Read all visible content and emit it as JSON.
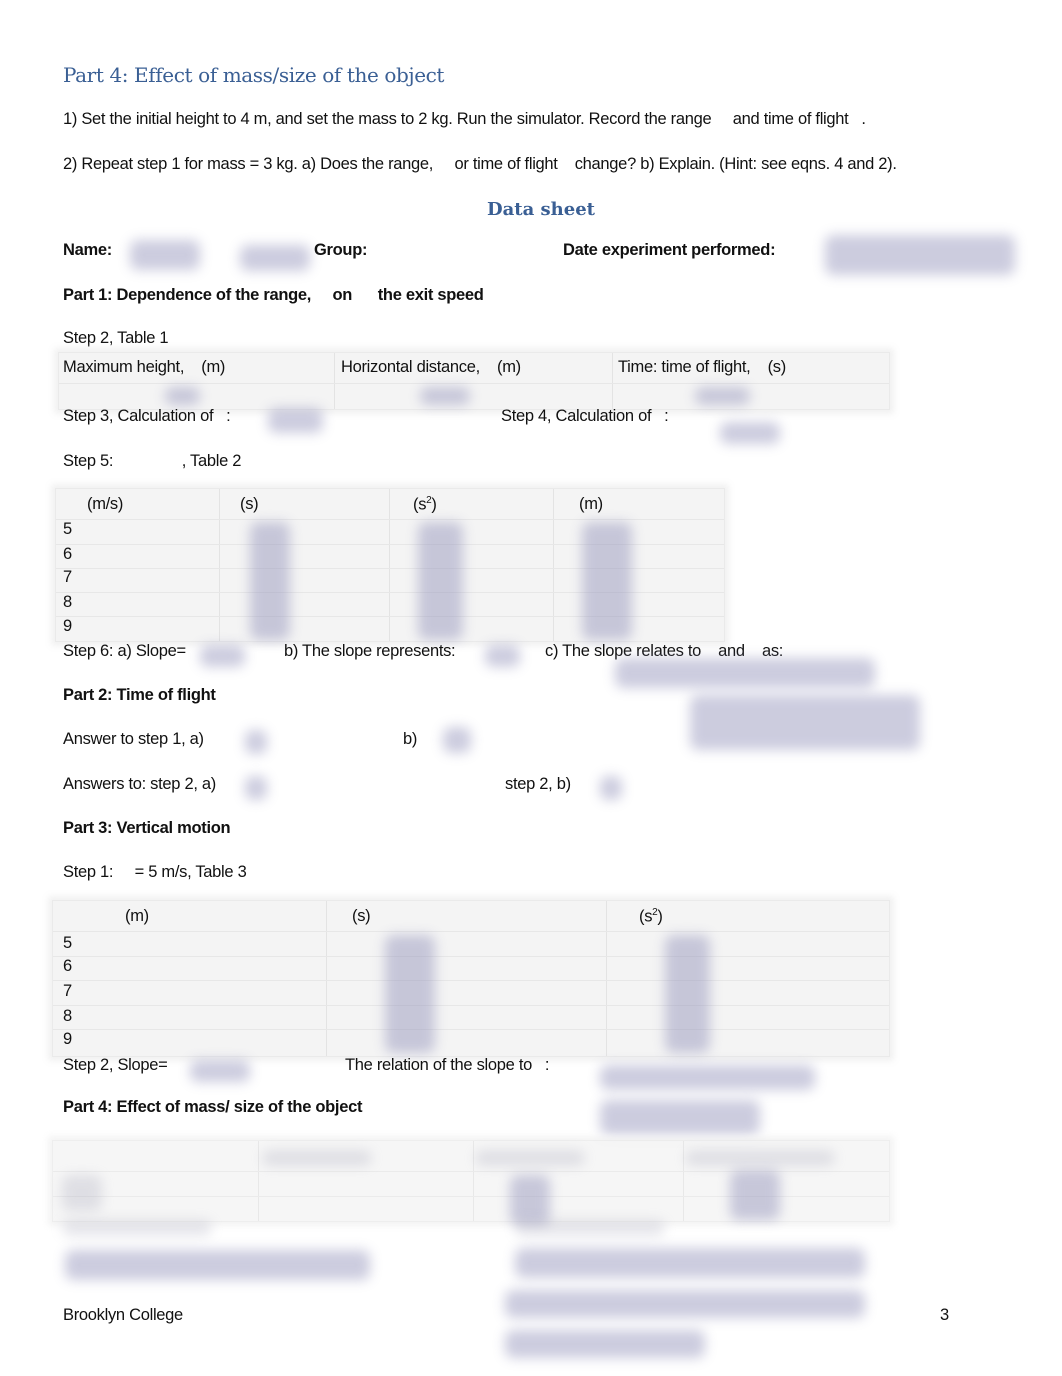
{
  "instructions": {
    "title": "Part 4: Effect of mass/size of the object",
    "step1": "1) Set the initial height to 4 m, and set the mass to 2 kg. Run the simulator. Record the range     and time of flight   .",
    "step2": "2) Repeat step 1 for mass = 3 kg. a) Does the range,     or time of flight    change? b) Explain. (Hint: see eqns. 4 and 2)."
  },
  "data_sheet": {
    "title": "Data sheet",
    "name_label": "Name:",
    "group_label": "Group:",
    "date_label": "Date experiment performed:"
  },
  "part1": {
    "heading": "Part 1: Dependence of the range,     on      the exit speed",
    "table1_label": "Step 2, Table 1",
    "table1_headers": [
      "Maximum height,    (m)",
      "Horizontal distance,    (m)",
      "Time: time of flight,    (s)"
    ],
    "step3_label": "Step 3, Calculation of   :",
    "step4_label": "Step 4, Calculation of   :",
    "step5_label": "Step 5:                , Table 2",
    "table2_headers": [
      "(m/s)",
      "(s)",
      "(s",
      "(m)"
    ],
    "table2_sup": "2",
    "table2_close": ")",
    "table2_rows": [
      "5",
      "6",
      "7",
      "8",
      "9"
    ],
    "step6_a": "Step 6: a) Slope=",
    "step6_b": "b) The slope represents:",
    "step6_c": "c) The slope relates to    and    as:"
  },
  "part2": {
    "heading": "Part 2: Time of flight",
    "step1_a": "Answer to step 1, a)",
    "step1_b": "b)",
    "step2_a": "Answers to: step 2, a)",
    "step2_b": "step 2, b)"
  },
  "part3": {
    "heading": "Part 3: Vertical motion",
    "step1_label": "Step 1:     = 5 m/s, Table 3",
    "table3_headers": [
      "(m)",
      "(s)",
      "(s"
    ],
    "table3_sup": "2",
    "table3_close": ")",
    "table3_rows": [
      "5",
      "6",
      "7",
      "8",
      "9"
    ],
    "step2_slope": "Step 2, Slope=",
    "step2_relation": "The relation of the slope to   :"
  },
  "part4": {
    "heading": "Part 4: Effect of mass/ size of the object"
  },
  "footer": {
    "left": "Brooklyn College",
    "page_number": "3"
  }
}
